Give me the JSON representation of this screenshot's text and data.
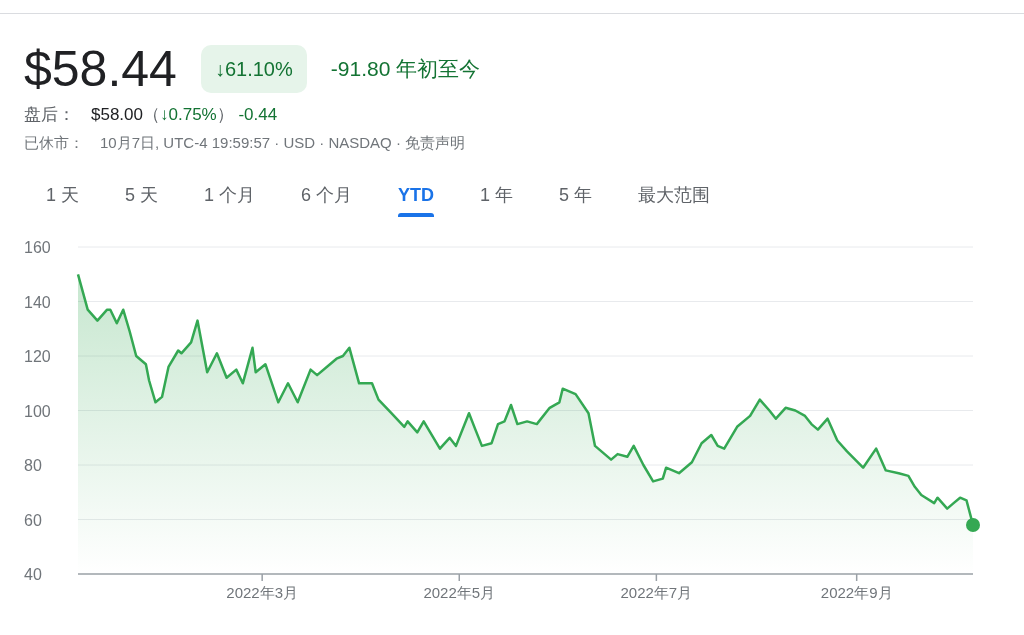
{
  "quote": {
    "price": "$58.44",
    "change_percent": "↓61.10%",
    "change": "-91.80",
    "period": "年初至今"
  },
  "after_hours": {
    "label": "盘后：",
    "price": "$58.00",
    "prefix": "（",
    "change_percent": "↓0.75%",
    "suffix": "）",
    "change": "-0.44"
  },
  "status": {
    "label": "已休市：",
    "details": "10月7日, UTC-4 19:59:57 · USD · NASDAQ ·",
    "disclaimer_link": "免责声明"
  },
  "tabs": [
    {
      "label": "1 天",
      "selected": false
    },
    {
      "label": "5 天",
      "selected": false
    },
    {
      "label": "1 个月",
      "selected": false
    },
    {
      "label": "6 个月",
      "selected": false
    },
    {
      "label": "YTD",
      "selected": true
    },
    {
      "label": "1 年",
      "selected": false
    },
    {
      "label": "5 年",
      "selected": false
    },
    {
      "label": "最大范围",
      "selected": false
    }
  ],
  "chart": {
    "chart_data": {
      "type": "area",
      "grid": true,
      "xlim": [
        "2022-01-03",
        "2022-10-07"
      ],
      "ylim": [
        40,
        160
      ],
      "yticks": [
        40,
        60,
        80,
        100,
        120,
        140,
        160
      ],
      "xticks": [
        {
          "value": "2022-03-01",
          "label": "2022年3月"
        },
        {
          "value": "2022-05-01",
          "label": "2022年5月"
        },
        {
          "value": "2022-07-01",
          "label": "2022年7月"
        },
        {
          "value": "2022-09-01",
          "label": "2022年9月"
        }
      ],
      "x": [
        "2022-01-03",
        "2022-01-06",
        "2022-01-09",
        "2022-01-12",
        "2022-01-13",
        "2022-01-15",
        "2022-01-17",
        "2022-01-19",
        "2022-01-21",
        "2022-01-24",
        "2022-01-25",
        "2022-01-27",
        "2022-01-29",
        "2022-01-31",
        "2022-02-03",
        "2022-02-04",
        "2022-02-07",
        "2022-02-09",
        "2022-02-12",
        "2022-02-15",
        "2022-02-18",
        "2022-02-21",
        "2022-02-23",
        "2022-02-26",
        "2022-02-27",
        "2022-03-02",
        "2022-03-06",
        "2022-03-09",
        "2022-03-12",
        "2022-03-16",
        "2022-03-18",
        "2022-03-22",
        "2022-03-24",
        "2022-03-26",
        "2022-03-28",
        "2022-03-31",
        "2022-04-04",
        "2022-04-06",
        "2022-04-10",
        "2022-04-14",
        "2022-04-15",
        "2022-04-18",
        "2022-04-20",
        "2022-04-25",
        "2022-04-28",
        "2022-04-30",
        "2022-05-04",
        "2022-05-06",
        "2022-05-08",
        "2022-05-11",
        "2022-05-13",
        "2022-05-15",
        "2022-05-17",
        "2022-05-19",
        "2022-05-22",
        "2022-05-25",
        "2022-05-29",
        "2022-06-01",
        "2022-06-02",
        "2022-06-06",
        "2022-06-10",
        "2022-06-12",
        "2022-06-17",
        "2022-06-19",
        "2022-06-22",
        "2022-06-24",
        "2022-06-27",
        "2022-06-30",
        "2022-07-03",
        "2022-07-04",
        "2022-07-08",
        "2022-07-12",
        "2022-07-15",
        "2022-07-18",
        "2022-07-20",
        "2022-07-22",
        "2022-07-26",
        "2022-07-30",
        "2022-08-02",
        "2022-08-05",
        "2022-08-07",
        "2022-08-10",
        "2022-08-13",
        "2022-08-16",
        "2022-08-18",
        "2022-08-20",
        "2022-08-23",
        "2022-08-26",
        "2022-08-29",
        "2022-09-03",
        "2022-09-07",
        "2022-09-10",
        "2022-09-14",
        "2022-09-17",
        "2022-09-19",
        "2022-09-21",
        "2022-09-25",
        "2022-09-26",
        "2022-09-29",
        "2022-10-01",
        "2022-10-03",
        "2022-10-05",
        "2022-10-07"
      ],
      "series": [
        {
          "color": "#34a853",
          "values": [
            150,
            137,
            133,
            137,
            137,
            132,
            137,
            129,
            120,
            117,
            111,
            103,
            105,
            116,
            122,
            121,
            125,
            133,
            114,
            121,
            112,
            115,
            110,
            123,
            114,
            117,
            103,
            110,
            103,
            115,
            113,
            117,
            119,
            120,
            123,
            110,
            110,
            104,
            99,
            94,
            96,
            92,
            96,
            86,
            90,
            87,
            99,
            93,
            87,
            88,
            95,
            96,
            102,
            95,
            96,
            95,
            101,
            103,
            108,
            106,
            99,
            87,
            82,
            84,
            83,
            87,
            80,
            74,
            75,
            79,
            77,
            81,
            88,
            91,
            87,
            86,
            94,
            98,
            104,
            100,
            97,
            101,
            100,
            98,
            95,
            93,
            97,
            89,
            85,
            79,
            86,
            78,
            77,
            76,
            72,
            69,
            66,
            68,
            64,
            66,
            68,
            67,
            58
          ]
        }
      ]
    }
  }
}
